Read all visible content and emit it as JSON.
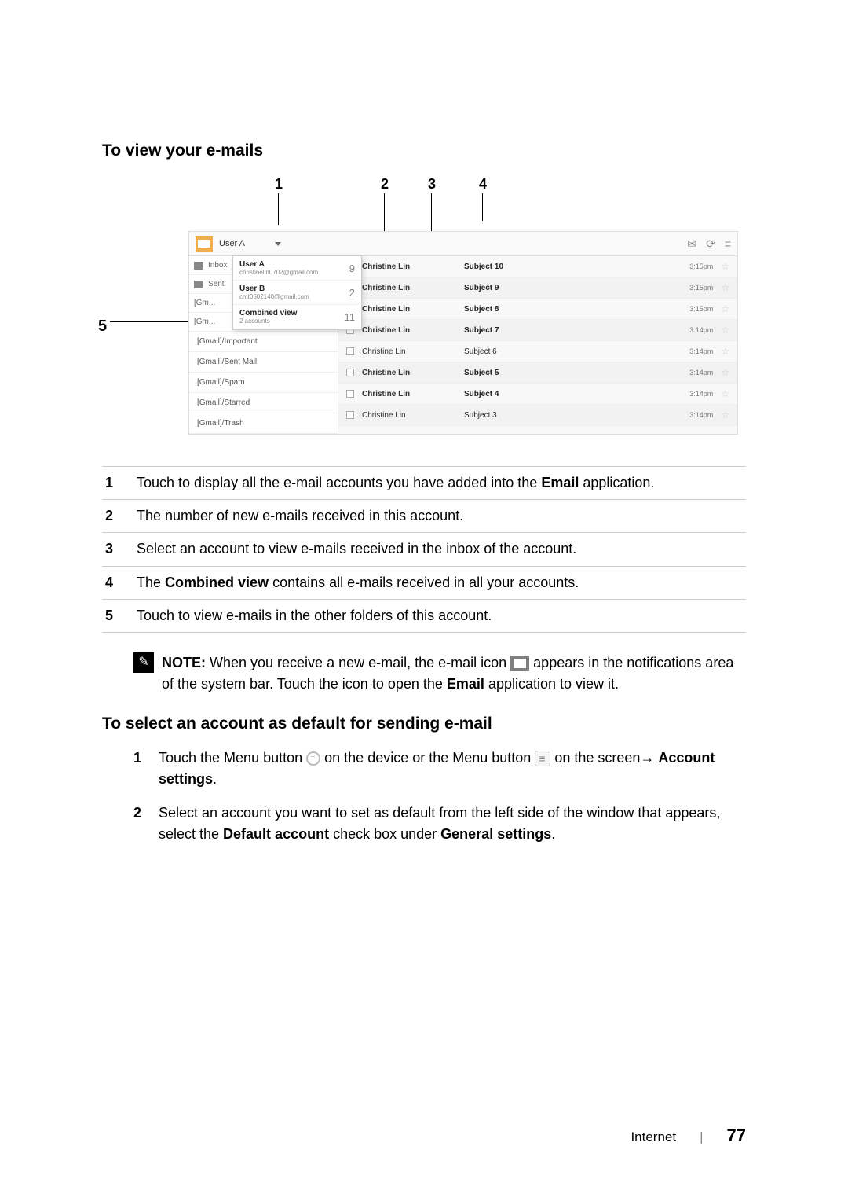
{
  "headings": {
    "view": "To view your e-mails",
    "select_default": "To select an account as default for sending e-mail"
  },
  "callouts": {
    "c1": "1",
    "c2": "2",
    "c3": "3",
    "c4": "4",
    "c5": "5"
  },
  "screenshot": {
    "titlebar": {
      "title": "User A"
    },
    "accounts": [
      {
        "name": "User A",
        "email": "christinelin0702@gmail.com",
        "count": "9"
      },
      {
        "name": "User B",
        "email": "cmt0502140@gmail.com",
        "count": "2"
      },
      {
        "name": "Combined view",
        "email": "2 accounts",
        "count": "11"
      }
    ],
    "sidebar": {
      "inbox": "Inbox",
      "sent": "Sent"
    },
    "folders": [
      "[Gmail]/Important",
      "[Gmail]/Sent Mail",
      "[Gmail]/Spam",
      "[Gmail]/Starred",
      "[Gmail]/Trash"
    ],
    "messages": [
      {
        "sender": "Christine Lin",
        "subject": "Subject 10",
        "time": "3:15pm",
        "bold": true
      },
      {
        "sender": "Christine Lin",
        "subject": "Subject 9",
        "time": "3:15pm",
        "bold": true
      },
      {
        "sender": "Christine Lin",
        "subject": "Subject 8",
        "time": "3:15pm",
        "bold": true
      },
      {
        "sender": "Christine Lin",
        "subject": "Subject 7",
        "time": "3:14pm",
        "bold": true
      },
      {
        "sender": "Christine Lin",
        "subject": "Subject 6",
        "time": "3:14pm",
        "bold": false
      },
      {
        "sender": "Christine Lin",
        "subject": "Subject 5",
        "time": "3:14pm",
        "bold": true
      },
      {
        "sender": "Christine Lin",
        "subject": "Subject 4",
        "time": "3:14pm",
        "bold": true
      },
      {
        "sender": "Christine Lin",
        "subject": "Subject 3",
        "time": "3:14pm",
        "bold": false
      }
    ]
  },
  "legend": {
    "r1": {
      "num": "1",
      "pre": "Touch to display all the e-mail accounts you have added into the ",
      "bold": "Email",
      "post": " application."
    },
    "r2": {
      "num": "2",
      "text": "The number of new e-mails received in this account."
    },
    "r3": {
      "num": "3",
      "text": "Select an account to view e-mails received in the inbox of the account."
    },
    "r4": {
      "num": "4",
      "pre": "The ",
      "bold": "Combined view",
      "post": " contains all e-mails received in all your accounts."
    },
    "r5": {
      "num": "5",
      "text": "Touch to view e-mails in the other folders of this account."
    }
  },
  "note": {
    "label": "NOTE:",
    "pre": " When you receive a new e-mail, the e-mail icon ",
    "mid": " appears in the notifications area of the system bar. Touch the icon to open the ",
    "bold": "Email",
    "post": " application to view it."
  },
  "steps": {
    "s1": {
      "num": "1",
      "a": "Touch the Menu button ",
      "b": " on the device or the Menu button ",
      "c": " on the screen→ ",
      "bold": "Account settings",
      "d": "."
    },
    "s2": {
      "num": "2",
      "a": "Select an account you want to set as default from the left side of the window that appears, select the ",
      "bold1": "Default account",
      "b": " check box under ",
      "bold2": "General settings",
      "c": "."
    }
  },
  "footer": {
    "section": "Internet",
    "page": "77"
  }
}
